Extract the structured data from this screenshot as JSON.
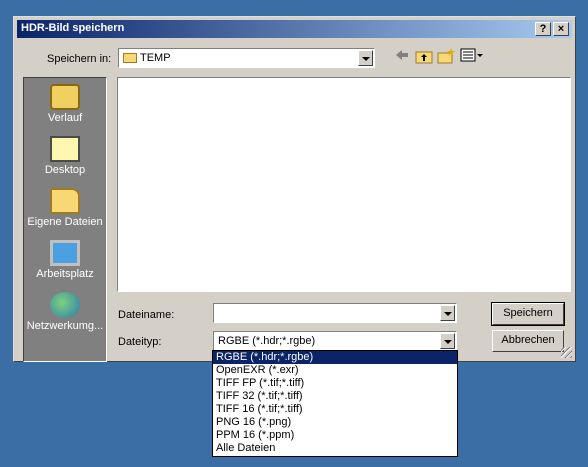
{
  "dialog": {
    "title": "HDR-Bild speichern",
    "help_label": "?",
    "close_label": "×"
  },
  "location": {
    "label": "Speichern in:",
    "value": "TEMP"
  },
  "toolbar": {
    "back_icon": "arrow-left-icon",
    "up_icon": "folder-up-icon",
    "new_folder_icon": "new-folder-icon",
    "view_menu_icon": "view-menu-icon"
  },
  "places": [
    {
      "label": "Verlauf",
      "icon": "history-icon"
    },
    {
      "label": "Desktop",
      "icon": "desktop-icon"
    },
    {
      "label": "Eigene Dateien",
      "icon": "my-documents-icon"
    },
    {
      "label": "Arbeitsplatz",
      "icon": "my-computer-icon"
    },
    {
      "label": "Netzwerkumg...",
      "icon": "network-icon"
    }
  ],
  "filename": {
    "label": "Dateiname:",
    "value": ""
  },
  "filetype": {
    "label": "Dateityp:",
    "value": "RGBE (*.hdr;*.rgbe)",
    "options": [
      "RGBE (*.hdr;*.rgbe)",
      "OpenEXR (*.exr)",
      "TIFF FP (*.tif;*.tiff)",
      "TIFF 32 (*.tif;*.tiff)",
      "TIFF 16 (*.tif;*.tiff)",
      "PNG 16 (*.png)",
      "PPM 16 (*.ppm)",
      "Alle Dateien"
    ],
    "selected_index": 0
  },
  "buttons": {
    "save_label": "Speichern",
    "cancel_label": "Abbrechen"
  },
  "colors": {
    "desktop": "#3a6ea5",
    "dialog_face": "#d4d0c8",
    "title_start": "#0a246a",
    "title_end": "#a6caf0",
    "selection": "#0a246a"
  }
}
